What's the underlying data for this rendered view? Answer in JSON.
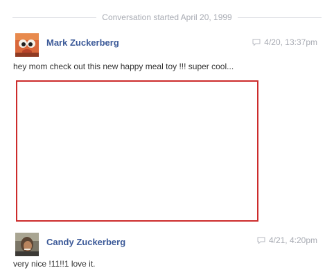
{
  "conversation": {
    "started_label": "Conversation started April 20, 1999"
  },
  "messages": [
    {
      "author": "Mark Zuckerberg",
      "timestamp": "4/20, 13:37pm",
      "body": "hey mom check out this new happy meal toy !!! super cool..."
    },
    {
      "author": "Candy Zuckerberg",
      "timestamp": "4/21, 4:20pm",
      "body": "very nice !11!!1 love it."
    }
  ],
  "colors": {
    "author_link": "#3b5998",
    "meta_text": "#a8abb3",
    "attachment_border": "#cc2b2b"
  },
  "icons": {
    "timestamp": "speech-bubble-icon"
  }
}
